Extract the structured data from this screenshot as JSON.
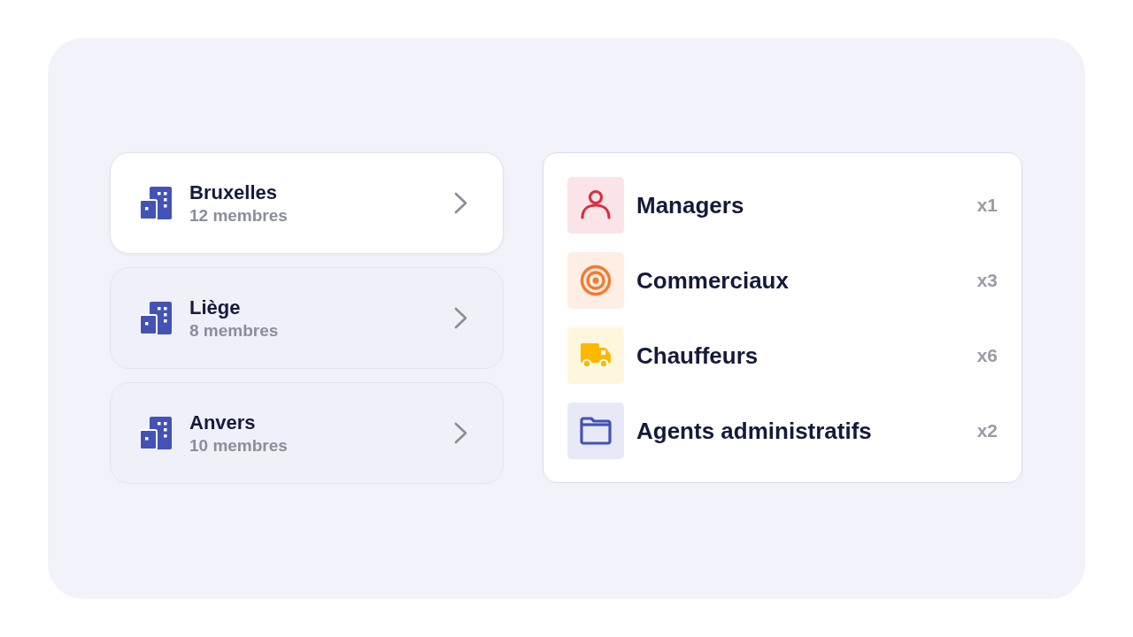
{
  "cities": [
    {
      "name": "Bruxelles",
      "members": "12 membres",
      "selected": true
    },
    {
      "name": "Liège",
      "members": "8 membres",
      "selected": false
    },
    {
      "name": "Anvers",
      "members": "10 membres",
      "selected": false
    }
  ],
  "roles": [
    {
      "label": "Managers",
      "count": "x1",
      "color": "#d62f43"
    },
    {
      "label": "Commerciaux",
      "count": "x3",
      "color": "#f47b2f"
    },
    {
      "label": "Chauffeurs",
      "count": "x6",
      "color": "#ffb800"
    },
    {
      "label": "Agents administratifs",
      "count": "x2",
      "color": "#4352b8"
    }
  ]
}
